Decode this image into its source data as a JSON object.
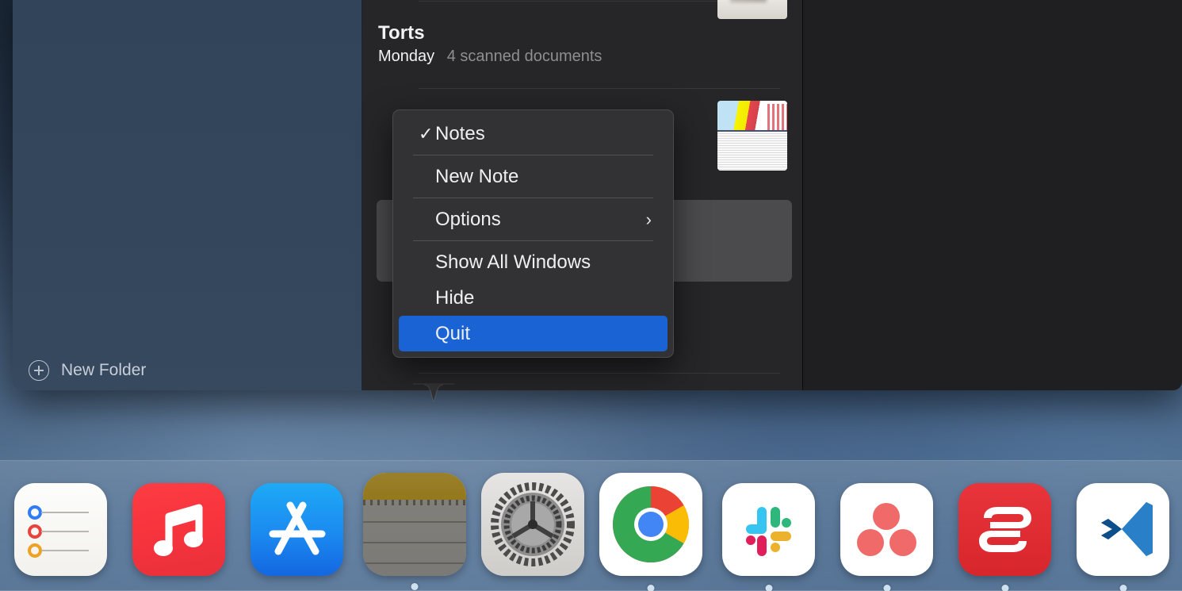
{
  "window": {
    "app": "Notes",
    "sidebar": {
      "new_folder_label": "New Folder",
      "new_folder_icon": "plus-circle-icon"
    },
    "note_list": {
      "notes": [
        {
          "title": "Torts",
          "date": "Monday",
          "snippet": "4 scanned documents",
          "thumbnail": "scanned-document-thumbnail"
        }
      ]
    }
  },
  "context_menu": {
    "owner": "Notes",
    "items": [
      {
        "label": "Notes",
        "checked": true,
        "kind": "app-name"
      },
      {
        "separator": true
      },
      {
        "label": "New Note",
        "kind": "action"
      },
      {
        "separator": true
      },
      {
        "label": "Options",
        "kind": "submenu",
        "submenu_arrow": "chevron-right-icon"
      },
      {
        "separator": true
      },
      {
        "label": "Show All Windows",
        "kind": "action"
      },
      {
        "label": "Hide",
        "kind": "action"
      },
      {
        "label": "Quit",
        "kind": "action",
        "highlighted": true
      }
    ],
    "highlight_color": "#1a63d4",
    "background_color": "#323234"
  },
  "dock": {
    "items": [
      {
        "name": "Reminders",
        "icon": "reminders-icon",
        "running": false
      },
      {
        "name": "Music",
        "icon": "music-icon",
        "running": false
      },
      {
        "name": "App Store",
        "icon": "app-store-icon",
        "running": false
      },
      {
        "name": "Notes",
        "icon": "notes-icon",
        "running": true
      },
      {
        "name": "System Preferences",
        "icon": "gear-icon",
        "running": false
      },
      {
        "name": "Google Chrome",
        "icon": "chrome-icon",
        "running": true
      },
      {
        "name": "Slack",
        "icon": "slack-icon",
        "running": true
      },
      {
        "name": "Asana",
        "icon": "asana-icon",
        "running": true
      },
      {
        "name": "ExpressVPN",
        "icon": "expressvpn-icon",
        "running": true
      },
      {
        "name": "Visual Studio Code",
        "icon": "vscode-icon",
        "running": true
      }
    ]
  }
}
